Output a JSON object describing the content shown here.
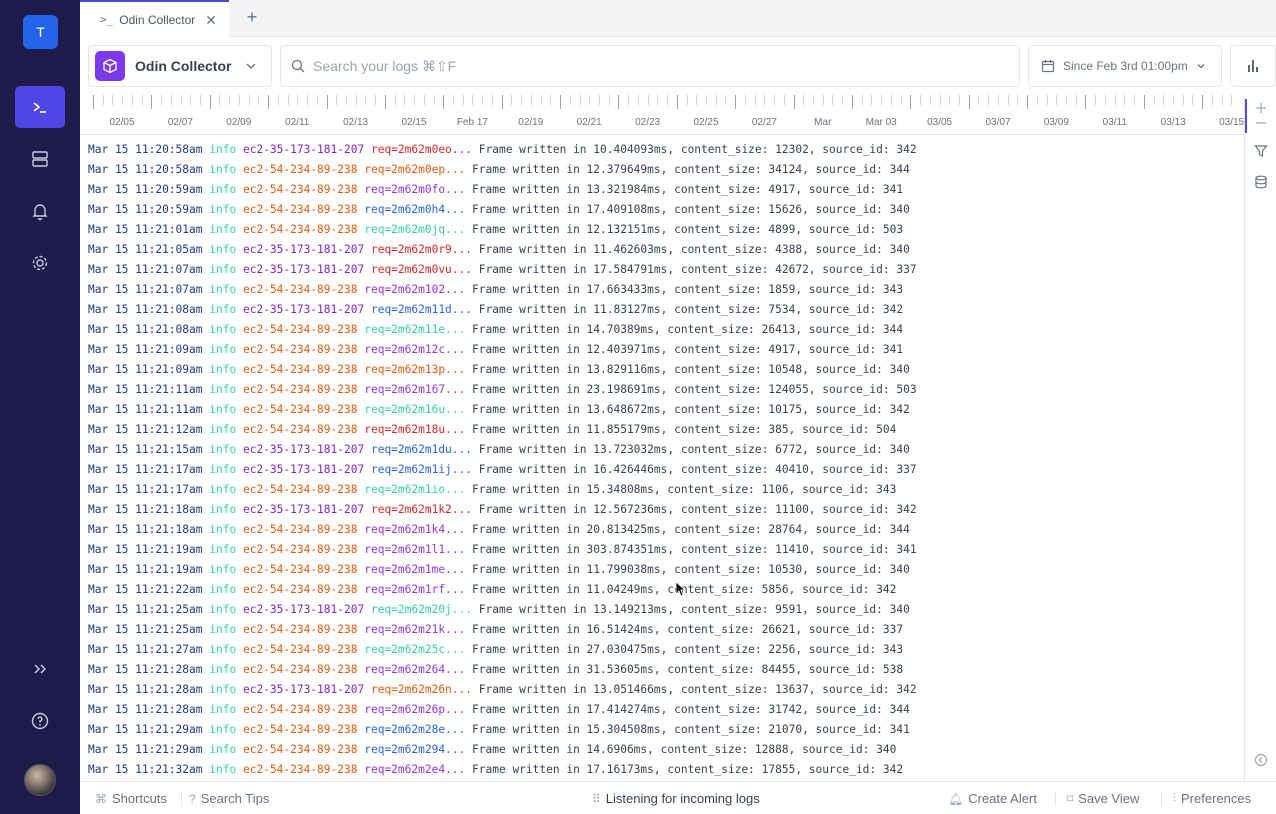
{
  "nav": {
    "workspace_initial": "T",
    "items": [
      "logs-icon",
      "sources-icon",
      "alerts-icon",
      "settings-icon"
    ],
    "expand": "expand-icon",
    "help": "help-icon"
  },
  "tabs": [
    {
      "label": "Odin Collector",
      "icon": ">_"
    }
  ],
  "toolbar": {
    "source": "Odin Collector",
    "search_placeholder": "Search your logs ⌘⇧F",
    "date_range": "Since Feb 3rd 01:00pm"
  },
  "timeline": {
    "labels": [
      "02/05",
      "02/07",
      "02/09",
      "02/11",
      "02/13",
      "02/15",
      "Feb 17",
      "02/19",
      "02/21",
      "02/23",
      "02/25",
      "02/27",
      "Mar",
      "Mar 03",
      "03/05",
      "03/07",
      "03/09",
      "03/11",
      "03/13",
      "03/15"
    ]
  },
  "logs": [
    {
      "time": "Mar 15 11:20:58am",
      "level": "info",
      "host": "ec2-35-173-181-207",
      "hc": "h-purple",
      "req": "req=2m62m0eo...",
      "rc": "r-red",
      "msg": "Frame written in 10.404093ms, content_size: 12302, source_id: 342"
    },
    {
      "time": "Mar 15 11:20:58am",
      "level": "info",
      "host": "ec2-54-234-89-238",
      "hc": "h-orange",
      "req": "req=2m62m0ep...",
      "rc": "r-orange",
      "msg": "Frame written in 12.379649ms, content_size: 34124, source_id: 344"
    },
    {
      "time": "Mar 15 11:20:59am",
      "level": "info",
      "host": "ec2-54-234-89-238",
      "hc": "h-orange",
      "req": "req=2m62m0fo...",
      "rc": "r-purple",
      "msg": "Frame written in 13.321984ms, content_size: 4917, source_id: 341"
    },
    {
      "time": "Mar 15 11:20:59am",
      "level": "info",
      "host": "ec2-54-234-89-238",
      "hc": "h-orange",
      "req": "req=2m62m0h4...",
      "rc": "r-blue",
      "msg": "Frame written in 17.409108ms, content_size: 15626, source_id: 340"
    },
    {
      "time": "Mar 15 11:21:01am",
      "level": "info",
      "host": "ec2-54-234-89-238",
      "hc": "h-orange",
      "req": "req=2m62m0jq...",
      "rc": "r-green",
      "msg": "Frame written in 12.132151ms, content_size: 4899, source_id: 503"
    },
    {
      "time": "Mar 15 11:21:05am",
      "level": "info",
      "host": "ec2-35-173-181-207",
      "hc": "h-purple",
      "req": "req=2m62m0r9...",
      "rc": "r-red",
      "msg": "Frame written in 11.462603ms, content_size: 4388, source_id: 340"
    },
    {
      "time": "Mar 15 11:21:07am",
      "level": "info",
      "host": "ec2-35-173-181-207",
      "hc": "h-purple",
      "req": "req=2m62m0vu...",
      "rc": "r-red",
      "msg": "Frame written in 17.584791ms, content_size: 42672, source_id: 337"
    },
    {
      "time": "Mar 15 11:21:07am",
      "level": "info",
      "host": "ec2-54-234-89-238",
      "hc": "h-orange",
      "req": "req=2m62m102...",
      "rc": "r-purple",
      "msg": "Frame written in 17.663433ms, content_size: 1859, source_id: 343"
    },
    {
      "time": "Mar 15 11:21:08am",
      "level": "info",
      "host": "ec2-35-173-181-207",
      "hc": "h-purple",
      "req": "req=2m62m11d...",
      "rc": "r-blue",
      "msg": "Frame written in 11.83127ms, content_size: 7534, source_id: 342"
    },
    {
      "time": "Mar 15 11:21:08am",
      "level": "info",
      "host": "ec2-54-234-89-238",
      "hc": "h-orange",
      "req": "req=2m62m11e...",
      "rc": "r-green",
      "msg": "Frame written in 14.70389ms, content_size: 26413, source_id: 344"
    },
    {
      "time": "Mar 15 11:21:09am",
      "level": "info",
      "host": "ec2-54-234-89-238",
      "hc": "h-orange",
      "req": "req=2m62m12c...",
      "rc": "r-purple",
      "msg": "Frame written in 12.403971ms, content_size: 4917, source_id: 341"
    },
    {
      "time": "Mar 15 11:21:09am",
      "level": "info",
      "host": "ec2-54-234-89-238",
      "hc": "h-orange",
      "req": "req=2m62m13p...",
      "rc": "r-orange",
      "msg": "Frame written in 13.829116ms, content_size: 10548, source_id: 340"
    },
    {
      "time": "Mar 15 11:21:11am",
      "level": "info",
      "host": "ec2-54-234-89-238",
      "hc": "h-orange",
      "req": "req=2m62m167...",
      "rc": "r-purple",
      "msg": "Frame written in 23.198691ms, content_size: 124055, source_id: 503"
    },
    {
      "time": "Mar 15 11:21:11am",
      "level": "info",
      "host": "ec2-54-234-89-238",
      "hc": "h-orange",
      "req": "req=2m62m16u...",
      "rc": "r-green",
      "msg": "Frame written in 13.648672ms, content_size: 10175, source_id: 342"
    },
    {
      "time": "Mar 15 11:21:12am",
      "level": "info",
      "host": "ec2-54-234-89-238",
      "hc": "h-orange",
      "req": "req=2m62m18u...",
      "rc": "r-red",
      "msg": "Frame written in 11.855179ms, content_size: 385, source_id: 504"
    },
    {
      "time": "Mar 15 11:21:15am",
      "level": "info",
      "host": "ec2-35-173-181-207",
      "hc": "h-purple",
      "req": "req=2m62m1du...",
      "rc": "r-blue",
      "msg": "Frame written in 13.723032ms, content_size: 6772, source_id: 340"
    },
    {
      "time": "Mar 15 11:21:17am",
      "level": "info",
      "host": "ec2-35-173-181-207",
      "hc": "h-purple",
      "req": "req=2m62m1ij...",
      "rc": "r-blue",
      "msg": "Frame written in 16.426446ms, content_size: 40410, source_id: 337"
    },
    {
      "time": "Mar 15 11:21:17am",
      "level": "info",
      "host": "ec2-54-234-89-238",
      "hc": "h-orange",
      "req": "req=2m62m1io...",
      "rc": "r-green",
      "msg": "Frame written in 15.34808ms, content_size: 1106, source_id: 343"
    },
    {
      "time": "Mar 15 11:21:18am",
      "level": "info",
      "host": "ec2-35-173-181-207",
      "hc": "h-purple",
      "req": "req=2m62m1k2...",
      "rc": "r-red",
      "msg": "Frame written in 12.567236ms, content_size: 11100, source_id: 342"
    },
    {
      "time": "Mar 15 11:21:18am",
      "level": "info",
      "host": "ec2-54-234-89-238",
      "hc": "h-orange",
      "req": "req=2m62m1k4...",
      "rc": "r-purple",
      "msg": "Frame written in 20.813425ms, content_size: 28764, source_id: 344"
    },
    {
      "time": "Mar 15 11:21:19am",
      "level": "info",
      "host": "ec2-54-234-89-238",
      "hc": "h-orange",
      "req": "req=2m62m1l1...",
      "rc": "r-purple",
      "msg": "Frame written in 303.874351ms, content_size: 11410, source_id: 341"
    },
    {
      "time": "Mar 15 11:21:19am",
      "level": "info",
      "host": "ec2-54-234-89-238",
      "hc": "h-orange",
      "req": "req=2m62m1me...",
      "rc": "r-purple",
      "msg": "Frame written in 11.799038ms, content_size: 10530, source_id: 340"
    },
    {
      "time": "Mar 15 11:21:22am",
      "level": "info",
      "host": "ec2-54-234-89-238",
      "hc": "h-orange",
      "req": "req=2m62m1rf...",
      "rc": "r-purple",
      "msg": "Frame written in 11.04249ms, content_size: 5856, source_id: 342"
    },
    {
      "time": "Mar 15 11:21:25am",
      "level": "info",
      "host": "ec2-35-173-181-207",
      "hc": "h-purple",
      "req": "req=2m62m20j...",
      "rc": "r-green",
      "msg": "Frame written in 13.149213ms, content_size: 9591, source_id: 340"
    },
    {
      "time": "Mar 15 11:21:25am",
      "level": "info",
      "host": "ec2-54-234-89-238",
      "hc": "h-orange",
      "req": "req=2m62m21k...",
      "rc": "r-purple",
      "msg": "Frame written in 16.51424ms, content_size: 26621, source_id: 337"
    },
    {
      "time": "Mar 15 11:21:27am",
      "level": "info",
      "host": "ec2-54-234-89-238",
      "hc": "h-orange",
      "req": "req=2m62m25c...",
      "rc": "r-green",
      "msg": "Frame written in 27.030475ms, content_size: 2256, source_id: 343"
    },
    {
      "time": "Mar 15 11:21:28am",
      "level": "info",
      "host": "ec2-54-234-89-238",
      "hc": "h-orange",
      "req": "req=2m62m264...",
      "rc": "r-purple",
      "msg": "Frame written in 31.53605ms, content_size: 84455, source_id: 538"
    },
    {
      "time": "Mar 15 11:21:28am",
      "level": "info",
      "host": "ec2-35-173-181-207",
      "hc": "h-purple",
      "req": "req=2m62m26n...",
      "rc": "r-orange",
      "msg": "Frame written in 13.051466ms, content_size: 13637, source_id: 342"
    },
    {
      "time": "Mar 15 11:21:28am",
      "level": "info",
      "host": "ec2-54-234-89-238",
      "hc": "h-orange",
      "req": "req=2m62m26p...",
      "rc": "r-purple",
      "msg": "Frame written in 17.414274ms, content_size: 31742, source_id: 344"
    },
    {
      "time": "Mar 15 11:21:29am",
      "level": "info",
      "host": "ec2-54-234-89-238",
      "hc": "h-orange",
      "req": "req=2m62m28e...",
      "rc": "r-blue",
      "msg": "Frame written in 15.304508ms, content_size: 21070, source_id: 341"
    },
    {
      "time": "Mar 15 11:21:29am",
      "level": "info",
      "host": "ec2-54-234-89-238",
      "hc": "h-orange",
      "req": "req=2m62m294...",
      "rc": "r-blue",
      "msg": "Frame written in 14.6906ms, content_size: 12888, source_id: 340"
    },
    {
      "time": "Mar 15 11:21:32am",
      "level": "info",
      "host": "ec2-54-234-89-238",
      "hc": "h-orange",
      "req": "req=2m62m2e4...",
      "rc": "r-purple",
      "msg": "Frame written in 17.16173ms, content_size: 17855, source_id: 342"
    }
  ],
  "footer": {
    "shortcuts": "Shortcuts",
    "search_tips": "Search Tips",
    "status": "Listening for incoming logs",
    "create_alert": "Create Alert",
    "save_view": "Save View",
    "preferences": "Preferences"
  },
  "colors": {
    "nav_bg": "#1e1b4b",
    "accent": "#4f46e5",
    "source_badge": "#7c3aed"
  }
}
